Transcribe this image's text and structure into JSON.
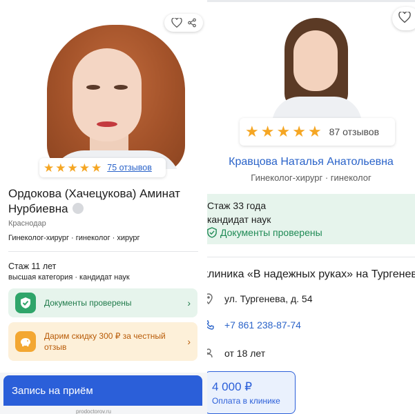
{
  "left_card": {
    "rating_stars": 5,
    "reviews_link": "75 отзывов",
    "doctor_name": "Ордокова (Хачецукова) Аминат Нурбиевна",
    "city": "Краснодар",
    "specialties": "Гинеколог-хирург · гинеколог · хирург",
    "experience": "Стаж 11 лет",
    "qualifications": "высшая категория · кандидат наук",
    "documents_banner": "Документы проверены",
    "discount_banner": "Дарим скидку 300 ₽ за честный отзыв",
    "book_button": "Запись на приём",
    "site_hint": "prodoctorov.ru"
  },
  "right_card": {
    "rating_stars": 5,
    "reviews": "87 отзывов",
    "doctor_name": "Кравцова Наталья Анатольевна",
    "specialties": "Гинеколог-хирург · гинеколог",
    "experience": "Стаж 33 года",
    "degree": "кандидат наук",
    "documents": "Документы проверены",
    "clinic_title": "клиника «В надежных руках» на Тургеневa",
    "address": "ул. Тургенева, д. 54",
    "phone": "+7 861 238-87-74",
    "age": "от 18 лет",
    "price": "4 000 ₽",
    "price_label": "Оплата в клинике"
  },
  "icons": {
    "favorite": "heart-icon",
    "share": "share-icon",
    "location": "location-pin-icon",
    "phone": "phone-icon",
    "person": "person-icon",
    "shield": "shield-check-icon",
    "piggy": "piggy-bank-icon"
  },
  "colors": {
    "accent_blue": "#2b5fd9",
    "link_blue": "#2a63c9",
    "star": "#f5a623",
    "green_bg": "#e6f4ec",
    "green_text": "#1f7a4a",
    "orange_bg": "#fdf0d9",
    "orange_text": "#b85a06"
  }
}
